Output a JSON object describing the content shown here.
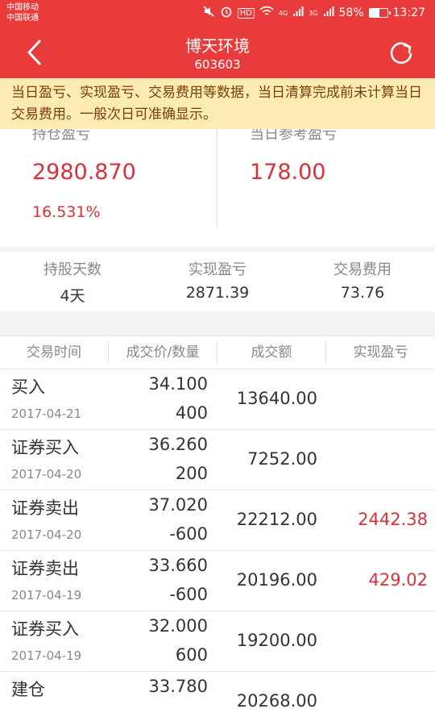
{
  "status_bar": {
    "carrier_1": "中国移动",
    "carrier_2": "中国联通",
    "hd_label": "HD",
    "network_1": "4G",
    "network_2": "3G",
    "battery": "58%",
    "battery_level": 0.58,
    "time": "13:27"
  },
  "header": {
    "title": "博天环境",
    "code": "603603"
  },
  "notice": "当日盈亏、实现盈亏、交易费用等数据，当日清算完成前未计算当日交易费用。一般次日可准确显示。",
  "summary": {
    "hold_label": "持仓盈亏",
    "hold_value": "2980.870",
    "hold_percent": "16.531%",
    "day_label": "当日参考盈亏",
    "day_value": "178.00"
  },
  "stats": [
    {
      "label": "持股天数",
      "value": "4天"
    },
    {
      "label": "实现盈亏",
      "value": "2871.39"
    },
    {
      "label": "交易费用",
      "value": "73.76"
    }
  ],
  "table": {
    "headers": [
      "交易时间",
      "成交价/数量",
      "成交额",
      "实现盈亏"
    ],
    "rows": [
      {
        "type": "买入",
        "date": "2017-04-21",
        "price": "34.100",
        "qty": "400",
        "amount": "13640.00",
        "pnl": ""
      },
      {
        "type": "证券买入",
        "date": "2017-04-20",
        "price": "36.260",
        "qty": "200",
        "amount": "7252.00",
        "pnl": ""
      },
      {
        "type": "证券卖出",
        "date": "2017-04-20",
        "price": "37.020",
        "qty": "-600",
        "amount": "22212.00",
        "pnl": "2442.38"
      },
      {
        "type": "证券卖出",
        "date": "2017-04-19",
        "price": "33.660",
        "qty": "-600",
        "amount": "20196.00",
        "pnl": "429.02"
      },
      {
        "type": "证券买入",
        "date": "2017-04-19",
        "price": "32.000",
        "qty": "600",
        "amount": "19200.00",
        "pnl": ""
      },
      {
        "type": "建仓",
        "date": "",
        "price": "33.780",
        "qty": "",
        "amount": "20268.00",
        "pnl": ""
      }
    ]
  }
}
